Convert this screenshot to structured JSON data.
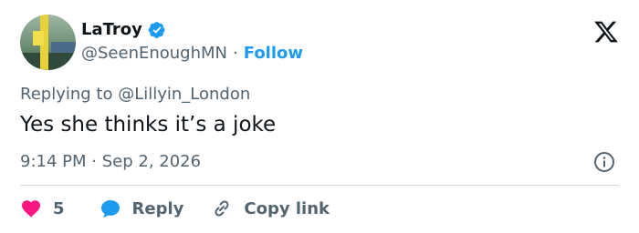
{
  "user": {
    "display_name": "LaTroy",
    "handle": "@SeenEnoughMN",
    "separator": "·",
    "follow_label": "Follow"
  },
  "tweet": {
    "replying_prefix": "Replying to ",
    "replying_to": "@Lillyin_London",
    "text": "Yes she thinks it’s a joke",
    "time": "9:14 PM",
    "time_separator": "·",
    "date": "Sep 2, 2026"
  },
  "actions": {
    "like_count": "5",
    "reply_label": "Reply",
    "copy_link_label": "Copy link"
  },
  "icons": {
    "verified": "verified-badge-icon",
    "brand": "x-logo-icon",
    "info": "info-icon",
    "like": "heart-icon",
    "reply": "chat-bubble-icon",
    "copy_link": "link-icon"
  },
  "colors": {
    "accent": "#1d9bf0",
    "like": "#f91880",
    "text_primary": "#0f1419",
    "text_secondary": "#536471",
    "divider": "#cfd9de"
  }
}
